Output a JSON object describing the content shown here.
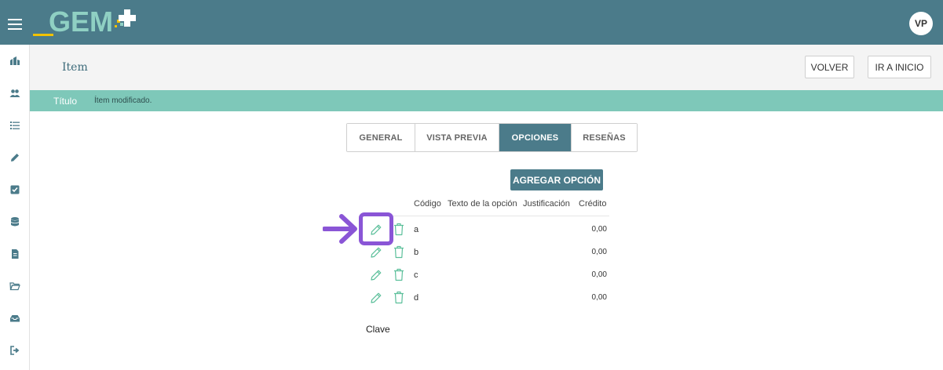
{
  "topbar": {
    "logo_text": "GEM",
    "avatar_initials": "VP"
  },
  "sidebar": {
    "items": [
      {
        "icon": "institution-icon"
      },
      {
        "icon": "users-icon"
      },
      {
        "icon": "list-icon"
      },
      {
        "icon": "pencil-icon"
      },
      {
        "icon": "checkbox-icon"
      },
      {
        "icon": "database-icon"
      },
      {
        "icon": "document-icon"
      },
      {
        "icon": "folder-open-icon"
      },
      {
        "icon": "inbox-icon"
      },
      {
        "icon": "sign-out-icon"
      }
    ]
  },
  "header": {
    "title": "Item",
    "back_label": "VOLVER",
    "home_label": "IR A INICIO"
  },
  "notice": {
    "title": "Título",
    "message": "Ítem modificado."
  },
  "tabs": [
    {
      "label": "GENERAL",
      "active": false
    },
    {
      "label": "VISTA PREVIA",
      "active": false
    },
    {
      "label": "OPCIONES",
      "active": true
    },
    {
      "label": "RESEÑAS",
      "active": false
    }
  ],
  "options": {
    "add_label": "AGREGAR OPCIÓN",
    "columns": [
      "Código",
      "Texto de la opción",
      "Justificación",
      "Crédito"
    ],
    "rows": [
      {
        "code": "a",
        "text": "",
        "justification": "",
        "credit": "0,00"
      },
      {
        "code": "b",
        "text": "",
        "justification": "",
        "credit": "0,00"
      },
      {
        "code": "c",
        "text": "",
        "justification": "",
        "credit": "0,00"
      },
      {
        "code": "d",
        "text": "",
        "justification": "",
        "credit": "0,00"
      }
    ]
  },
  "key_label": "Clave",
  "colors": {
    "primary": "#4b7b8a",
    "notice": "#7ec8b9",
    "icon_green": "#5bbf9a",
    "highlight": "#8a55d6",
    "logo_yellow": "#f2c200"
  }
}
